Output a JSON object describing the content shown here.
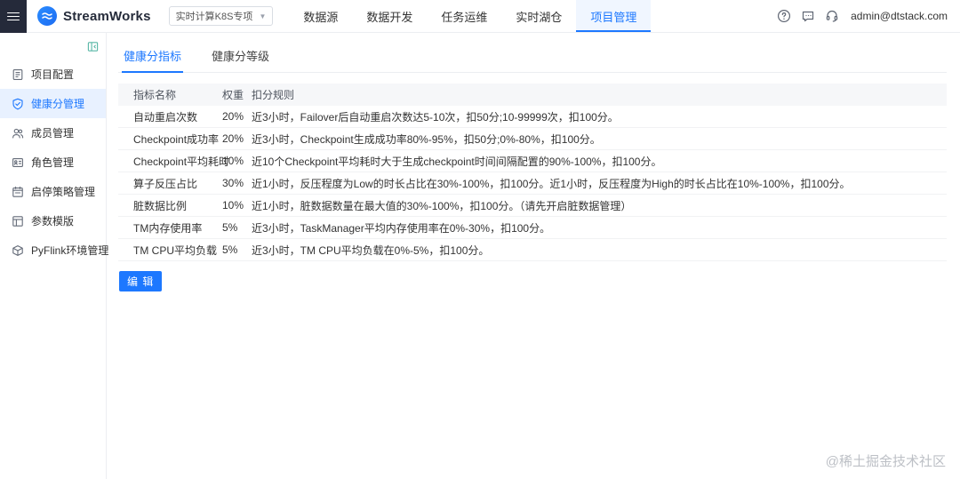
{
  "header": {
    "brand": "StreamWorks",
    "project_selector": {
      "value": "实时计算K8S专项"
    },
    "nav": [
      {
        "label": "数据源"
      },
      {
        "label": "数据开发"
      },
      {
        "label": "任务运维"
      },
      {
        "label": "实时湖仓"
      },
      {
        "label": "项目管理"
      }
    ],
    "icons": [
      "help-icon",
      "message-icon",
      "support-icon"
    ],
    "user_email": "admin@dtstack.com"
  },
  "sidebar": {
    "items": [
      {
        "label": "项目配置"
      },
      {
        "label": "健康分管理"
      },
      {
        "label": "成员管理"
      },
      {
        "label": "角色管理"
      },
      {
        "label": "启停策略管理"
      },
      {
        "label": "参数模版"
      },
      {
        "label": "PyFlink环境管理"
      }
    ]
  },
  "main": {
    "tabs": [
      {
        "label": "健康分指标"
      },
      {
        "label": "健康分等级"
      }
    ],
    "table": {
      "headers": [
        "指标名称",
        "权重",
        "扣分规则"
      ],
      "rows": [
        {
          "name": "自动重启次数",
          "weight": "20%",
          "rule": "近3小时，Failover后自动重启次数达5-10次，扣50分;10-99999次，扣100分。"
        },
        {
          "name": "Checkpoint成功率",
          "weight": "20%",
          "rule": "近3小时，Checkpoint生成成功率80%-95%，扣50分;0%-80%，扣100分。"
        },
        {
          "name": "Checkpoint平均耗时",
          "weight": "10%",
          "rule": "近10个Checkpoint平均耗时大于生成checkpoint时间间隔配置的90%-100%，扣100分。"
        },
        {
          "name": "算子反压占比",
          "weight": "30%",
          "rule": "近1小时，反压程度为Low的时长占比在30%-100%，扣100分。近1小时，反压程度为High的时长占比在10%-100%，扣100分。"
        },
        {
          "name": "脏数据比例",
          "weight": "10%",
          "rule": "近1小时，脏数据数量在最大值的30%-100%，扣100分。（请先开启脏数据管理）"
        },
        {
          "name": "TM内存使用率",
          "weight": "5%",
          "rule": "近3小时，TaskManager平均内存使用率在0%-30%，扣100分。"
        },
        {
          "name": "TM CPU平均负载",
          "weight": "5%",
          "rule": "近3小时，TM CPU平均负载在0%-5%，扣100分。"
        }
      ]
    },
    "edit_button": "编 辑"
  },
  "watermark": "@稀土掘金技术社区",
  "colors": {
    "accent": "#1d78ff"
  }
}
